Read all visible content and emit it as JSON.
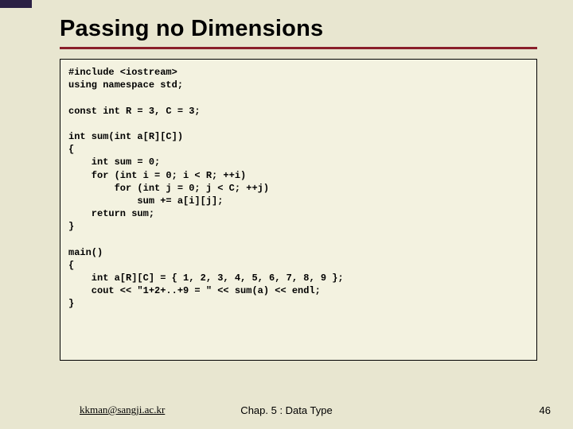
{
  "title": "Passing no Dimensions",
  "code": "#include <iostream>\nusing namespace std;\n\nconst int R = 3, C = 3;\n\nint sum(int a[R][C])\n{\n    int sum = 0;\n    for (int i = 0; i < R; ++i)\n        for (int j = 0; j < C; ++j)\n            sum += a[i][j];\n    return sum;\n}\n\nmain()\n{\n    int a[R][C] = { 1, 2, 3, 4, 5, 6, 7, 8, 9 };\n    cout << \"1+2+..+9 = \" << sum(a) << endl;\n}",
  "footer": {
    "left": "kkman@sangji.ac.kr",
    "center": "Chap. 5 : Data Type",
    "right": "46"
  }
}
